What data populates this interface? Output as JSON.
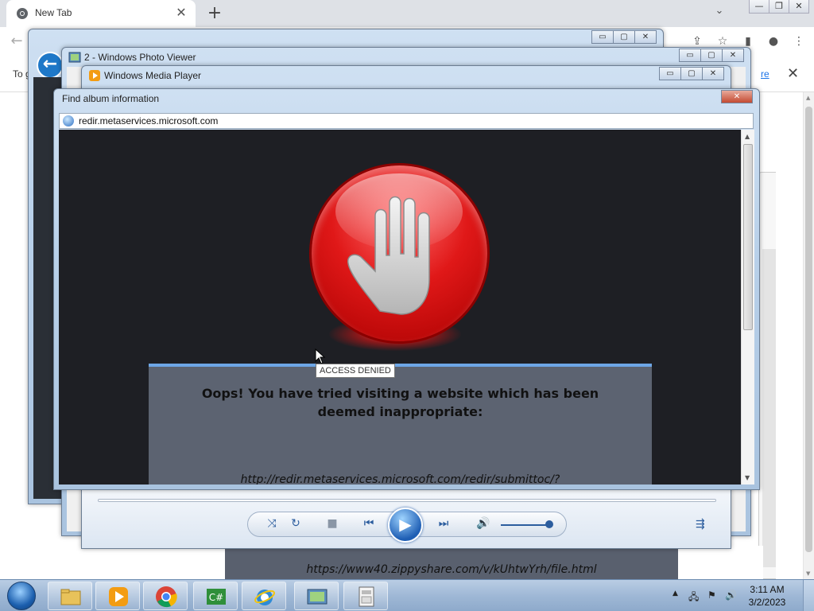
{
  "browser": {
    "tab_title": "New Tab",
    "tab_close": "✕",
    "new_tab": "+",
    "tab_search": "⌄",
    "win_minimize": "—",
    "win_restore": "❐",
    "win_close": "✕",
    "back": "←",
    "infobar_text": "To g",
    "infobar_link": "re",
    "infobar_close": "✕"
  },
  "windows": {
    "photo_viewer_title": "2 - Windows Photo Viewer",
    "media_player_title": "Windows Media Player",
    "dialog_title": "Find album information",
    "btn_minimize": "▭",
    "btn_maximize": "▢",
    "btn_close": "✕"
  },
  "dialog": {
    "address": "redir.metaservices.microsoft.com",
    "message": "Oops! You have tried visiting a website which has been deemed inappropriate:",
    "url": "http://redir.metaservices.microsoft.com/redir/submittoc/?",
    "tooltip": "ACCESS DENIED"
  },
  "page": {
    "url2": "https://www40.zippyshare.com/v/kUhtwYrh/file.html"
  },
  "player": {
    "shuffle": "⤨",
    "repeat": "↻",
    "stop": "■",
    "prev": "⏮",
    "play": "▶",
    "next": "⏭",
    "volume": "🔊",
    "switch_view": "⇶"
  },
  "taskbar": {
    "time": "3:11 AM",
    "date": "3/2/2023",
    "tray_arrow": "▲",
    "tray_network": "🖧",
    "tray_flag": "⚑",
    "tray_volume": "🔊"
  },
  "colors": {
    "stop_red": "#e01818",
    "dialog_bg": "#1e1f24",
    "panel_bg": "#5c6371",
    "panel_border": "#6da6e6"
  }
}
